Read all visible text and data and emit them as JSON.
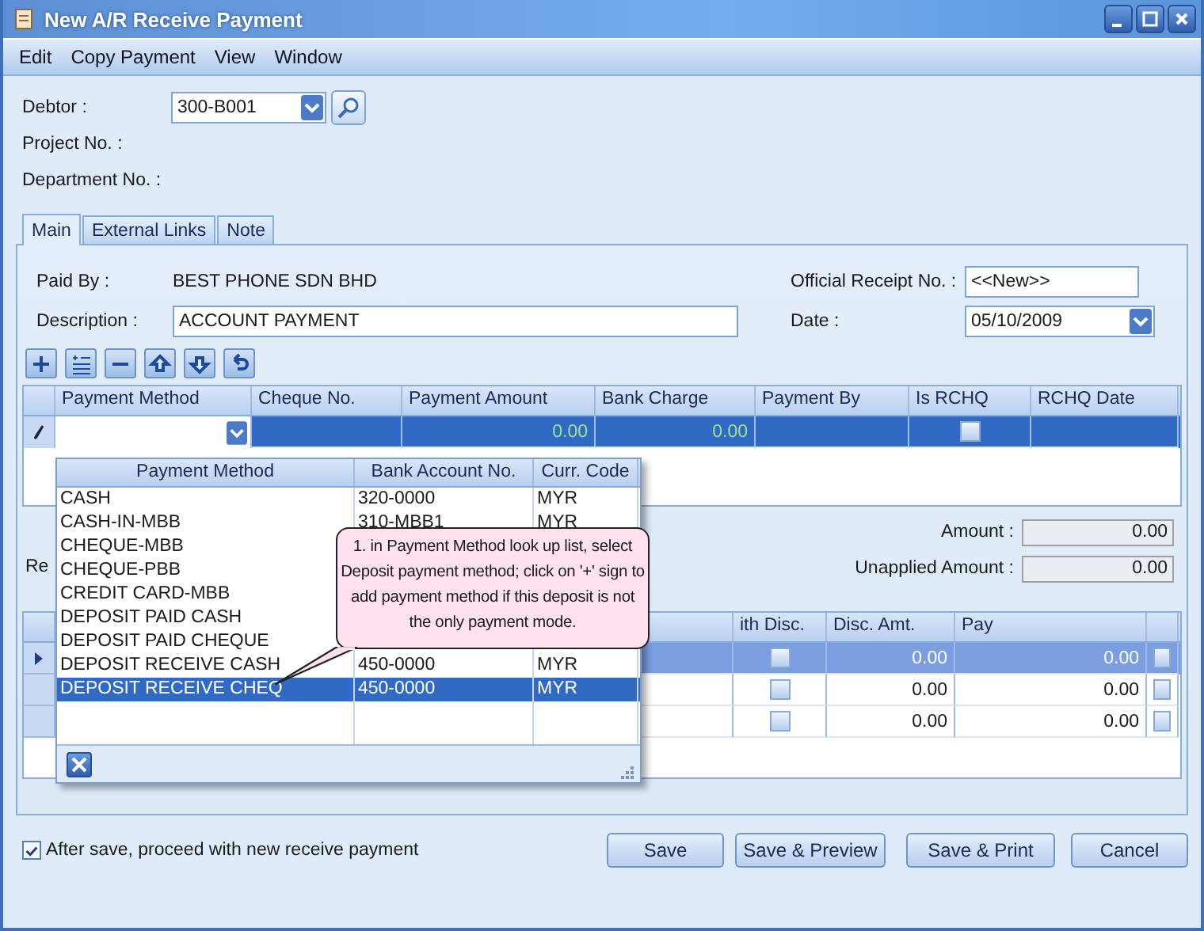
{
  "window": {
    "title": "New A/R Receive Payment"
  },
  "menu": [
    {
      "label": "Edit"
    },
    {
      "label": "Copy Payment"
    },
    {
      "label": "View"
    },
    {
      "label": "Window"
    }
  ],
  "header": {
    "debtor_label": "Debtor :",
    "debtor": "300-B001",
    "project_label": "Project No. :",
    "department_label": "Department No. :"
  },
  "tabs": [
    {
      "label": "Main",
      "selected": true
    },
    {
      "label": "External Links",
      "selected": false
    },
    {
      "label": "Note",
      "selected": false
    }
  ],
  "main": {
    "paid_by_label": "Paid By :",
    "paid_by": "BEST PHONE SDN BHD",
    "description_label": "Description :",
    "description": "ACCOUNT PAYMENT",
    "receipt_label": "Official Receipt No. :",
    "receipt": "<<New>>",
    "date_label": "Date :",
    "date": "05/10/2009"
  },
  "toolbar": [
    {
      "kind": "add"
    },
    {
      "kind": "insert"
    },
    {
      "kind": "delete"
    },
    {
      "kind": "up"
    },
    {
      "kind": "down"
    },
    {
      "kind": "undo"
    }
  ],
  "payment_grid": {
    "columns": [
      "Payment Method",
      "Cheque No.",
      "Payment Amount",
      "Bank Charge",
      "Payment By",
      "Is RCHQ",
      "RCHQ Date"
    ],
    "rows": [
      {
        "selected": true,
        "payment_amount": "0.00",
        "bank_charge": "0.00",
        "is_rchq": false
      }
    ]
  },
  "summary": {
    "partial_label": "Re",
    "amount_label": "Amount :",
    "amount": "0.00",
    "unapplied_label": "Unapplied Amount :",
    "unapplied": "0.00"
  },
  "detail_grid": {
    "columns": [
      "ith Disc.",
      "Disc. Amt.",
      "Pay"
    ],
    "rows": [
      {
        "selected": true,
        "with_disc": false,
        "disc_amt": "0.00",
        "pay": "0.00",
        "checked": false
      },
      {
        "selected": false,
        "with_disc": false,
        "disc_amt": "0.00",
        "pay": "0.00",
        "checked": false
      },
      {
        "selected": false,
        "with_disc": false,
        "disc_amt": "0.00",
        "pay": "0.00",
        "checked": false
      }
    ]
  },
  "lookup": {
    "columns": [
      "Payment Method",
      "Bank Account No.",
      "Curr. Code"
    ],
    "rows": [
      {
        "method": "CASH",
        "account": "320-0000",
        "currency": "MYR",
        "selected": false
      },
      {
        "method": "CASH-IN-MBB",
        "account": "310-MBB1",
        "currency": "MYR",
        "selected": false
      },
      {
        "method": "CHEQUE-MBB",
        "selected": false
      },
      {
        "method": "CHEQUE-PBB",
        "selected": false
      },
      {
        "method": "CREDIT CARD-MBB",
        "selected": false
      },
      {
        "method": "DEPOSIT PAID CASH",
        "selected": false
      },
      {
        "method": "DEPOSIT PAID CHEQUE",
        "selected": false
      },
      {
        "method": "DEPOSIT RECEIVE CASH",
        "account": "450-0000",
        "currency": "MYR",
        "selected": false
      },
      {
        "method": "DEPOSIT RECEIVE CHEQ",
        "account": "450-0000",
        "currency": "MYR",
        "selected": true
      }
    ]
  },
  "callout": {
    "text": "1. in Payment Method look up list, select Deposit payment method; click on '+' sign to add payment method if this deposit is not the only payment mode."
  },
  "footer": {
    "proceed_label": "After save, proceed with new receive payment",
    "proceed_checked": true,
    "buttons": [
      "Save",
      "Save & Preview",
      "Save & Print",
      "Cancel"
    ]
  }
}
